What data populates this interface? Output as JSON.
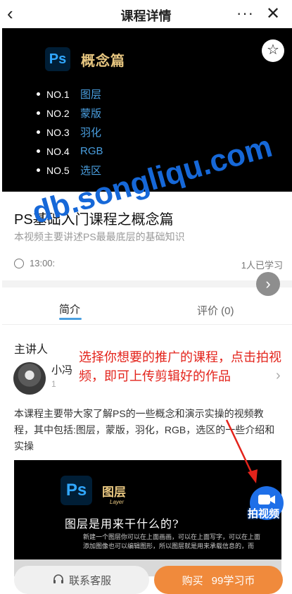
{
  "header": {
    "back_icon": "‹",
    "title": "课程详情",
    "more_icon": "···",
    "close_icon": "✕"
  },
  "banner": {
    "logo_text": "Ps",
    "title": "概念篇",
    "star_icon": "☆",
    "items": [
      {
        "no": "NO.1",
        "name": "图层"
      },
      {
        "no": "NO.2",
        "name": "蒙版"
      },
      {
        "no": "NO.3",
        "name": "羽化"
      },
      {
        "no": "NO.4",
        "name": "RGB"
      },
      {
        "no": "NO.5",
        "name": "选区"
      }
    ]
  },
  "course": {
    "title": "PS基础入门课程之概念篇",
    "subtitle": "本视频主要讲述PS最最底层的基础知识",
    "time": "13:00:",
    "learners": "1人已学习"
  },
  "watermark": "db.songliqu.com",
  "tabs": {
    "intro": "简介",
    "review": "评价 (0)"
  },
  "lecturer": {
    "label": "主讲人",
    "name": "小冯",
    "count": "1"
  },
  "annotation": "选择你想要的推广的课程，点击拍视频，即可上传剪辑好的作品",
  "description": "本课程主要带大家了解PS的一些概念和演示实操的视频教程，其中包括:图层，蒙版，羽化，RGB，选区的一些介绍和实操",
  "preview": {
    "logo_text": "Ps",
    "title": "图层",
    "subtitle": "Layer",
    "question": "图层是用来干什么的?",
    "body": "新建一个图层你可以在上面画画，可以在上面写字，可以在上面添加图像也可以编辑图形，所以图层就是用来承载信息的，而"
  },
  "shoot_button": {
    "label": "拍视频",
    "icon": "video-camera-icon"
  },
  "bottom": {
    "service_label": "联系客服",
    "buy_label": "购买",
    "price": "99学习币"
  },
  "colors": {
    "accent_blue": "#4a9fe0",
    "buy_orange": "#f08a3c",
    "annotation_red": "#e3231b",
    "watermark_blue": "#1668d8"
  }
}
